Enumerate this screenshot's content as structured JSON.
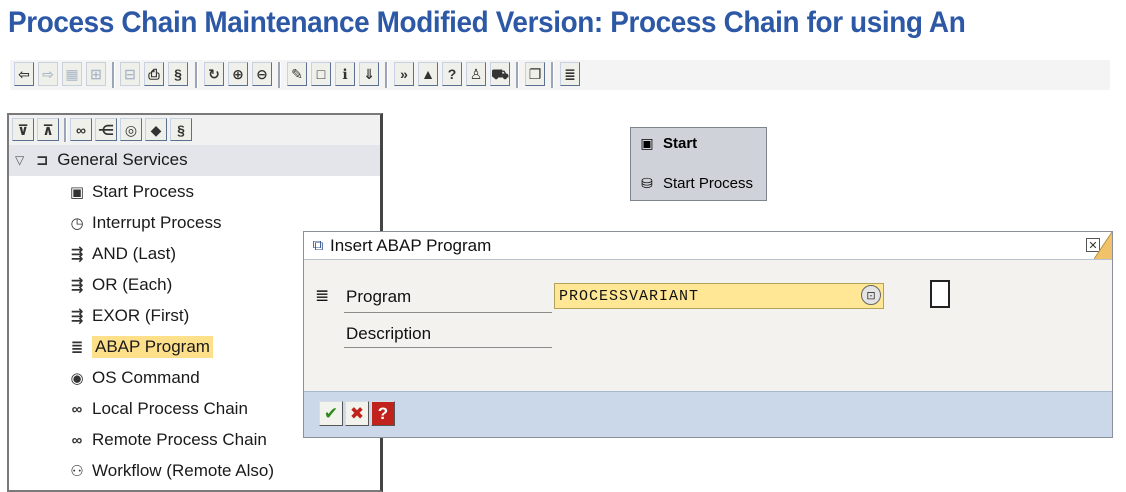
{
  "page": {
    "title": "Process Chain Maintenance Modified Version: Process Chain for using An"
  },
  "toolbar": {
    "buttons": [
      {
        "icon": "arrow-left-icon",
        "glyph": "⇦"
      },
      {
        "icon": "arrow-right-icon",
        "glyph": "⇨"
      },
      {
        "icon": "grid-icon",
        "glyph": "▦"
      },
      {
        "icon": "hierarchy-icon",
        "glyph": "⊞"
      },
      {
        "icon": "table-icon",
        "glyph": "⊟"
      },
      {
        "icon": "save-icon",
        "glyph": "⎙"
      },
      {
        "icon": "scroll-icon",
        "glyph": "§"
      },
      {
        "icon": "refresh-icon",
        "glyph": "↻"
      },
      {
        "icon": "zoom-in-icon",
        "glyph": "⊕"
      },
      {
        "icon": "zoom-out-icon",
        "glyph": "⊖"
      },
      {
        "icon": "edit-icon",
        "glyph": "✎"
      },
      {
        "icon": "new-document-icon",
        "glyph": "□"
      },
      {
        "icon": "info-icon",
        "glyph": "ℹ"
      },
      {
        "icon": "download-icon",
        "glyph": "⇓"
      },
      {
        "icon": "activate-icon",
        "glyph": "»"
      },
      {
        "icon": "chart-icon",
        "glyph": "▲"
      },
      {
        "icon": "help-icon",
        "glyph": "?"
      },
      {
        "icon": "user-icon",
        "glyph": "♙"
      },
      {
        "icon": "transport-icon",
        "glyph": "⛟"
      },
      {
        "icon": "copy-icon",
        "glyph": "❐"
      },
      {
        "icon": "list-icon",
        "glyph": "≣"
      }
    ]
  },
  "tree": {
    "toolbar": [
      {
        "icon": "expand-all-icon",
        "glyph": "⊽"
      },
      {
        "icon": "collapse-all-icon",
        "glyph": "⊼"
      },
      {
        "icon": "link-icon",
        "glyph": "∞"
      },
      {
        "icon": "tree-icon",
        "glyph": "⋲"
      },
      {
        "icon": "target-icon",
        "glyph": "◎"
      },
      {
        "icon": "tag-icon",
        "glyph": "◆"
      },
      {
        "icon": "document-icon",
        "glyph": "§"
      }
    ],
    "root": {
      "label": "General Services",
      "icon": "network-folder-icon",
      "glyph": "⊐"
    },
    "items": [
      {
        "label": "Start Process",
        "icon": "start-process-icon",
        "glyph": "▣"
      },
      {
        "label": "Interrupt Process",
        "icon": "interrupt-process-icon",
        "glyph": "◷"
      },
      {
        "label": "AND (Last)",
        "icon": "and-icon",
        "glyph": "⇶"
      },
      {
        "label": "OR (Each)",
        "icon": "or-icon",
        "glyph": "⇶"
      },
      {
        "label": "EXOR (First)",
        "icon": "exor-icon",
        "glyph": "⇶"
      },
      {
        "label": "ABAP Program",
        "icon": "abap-program-icon",
        "glyph": "≣"
      },
      {
        "label": "OS Command",
        "icon": "os-command-icon",
        "glyph": "◉"
      },
      {
        "label": "Local Process Chain",
        "icon": "local-process-chain-icon",
        "glyph": "∞"
      },
      {
        "label": "Remote Process Chain",
        "icon": "remote-process-chain-icon",
        "glyph": "∞"
      },
      {
        "label": "Workflow (Remote Also)",
        "icon": "workflow-icon",
        "glyph": "⚇"
      }
    ],
    "selected_index": 5
  },
  "canvas": {
    "start_node": {
      "title": "Start",
      "title_icon": "start-icon",
      "title_glyph": "▣",
      "subtitle": "Start Process",
      "subtitle_icon": "process-icon",
      "subtitle_glyph": "⛁"
    }
  },
  "dialog": {
    "title": "Insert ABAP Program",
    "title_icon": "dialog-window-icon",
    "fields": {
      "program_label": "Program",
      "program_value": "PROCESSVARIANT",
      "description_label": "Description"
    },
    "footer": [
      {
        "icon": "check-icon",
        "glyph": "✔",
        "color": "#2e8b1a"
      },
      {
        "icon": "cancel-icon",
        "glyph": "✖",
        "color": "#c0221c"
      },
      {
        "icon": "help-icon",
        "glyph": "?",
        "color": "#c0221c"
      }
    ]
  }
}
